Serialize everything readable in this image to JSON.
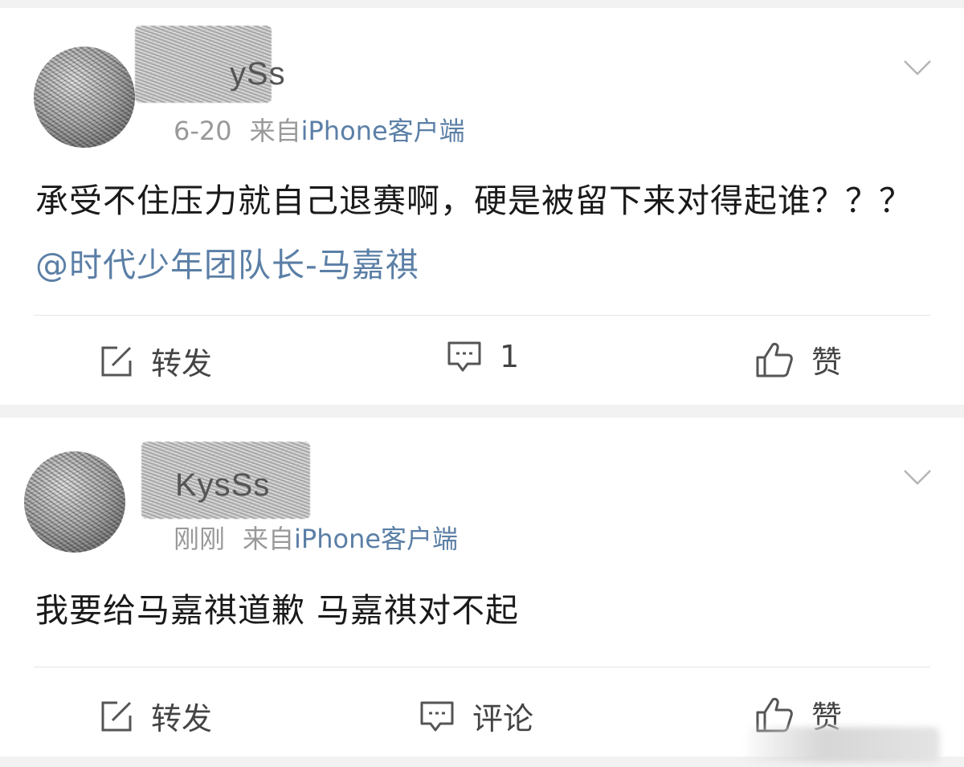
{
  "posts": [
    {
      "username_visible": "ySs",
      "time": "6-20",
      "source_prefix": "来自",
      "source": "iPhone客户端",
      "content_text": "承受不住压力就自己退赛啊，硬是被留下来对得起谁？？？",
      "mention": "@时代少年团队长-马嘉祺",
      "actions": {
        "repost_label": "转发",
        "comment_label": "1",
        "like_label": "赞"
      }
    },
    {
      "username_visible": "KysSs",
      "time": "刚刚",
      "source_prefix": "来自",
      "source": "iPhone客户端",
      "content_text": "我要给马嘉祺道歉 马嘉祺对不起",
      "actions": {
        "repost_label": "转发",
        "comment_label": "评论",
        "like_label": "赞"
      }
    }
  ],
  "icons": [
    "repost-icon",
    "comment-icon",
    "like-icon",
    "chevron-down-icon"
  ],
  "colors": {
    "link": "#5b7fa6",
    "meta": "#999999",
    "text": "#1a1a1a",
    "background": "#f2f2f2"
  }
}
